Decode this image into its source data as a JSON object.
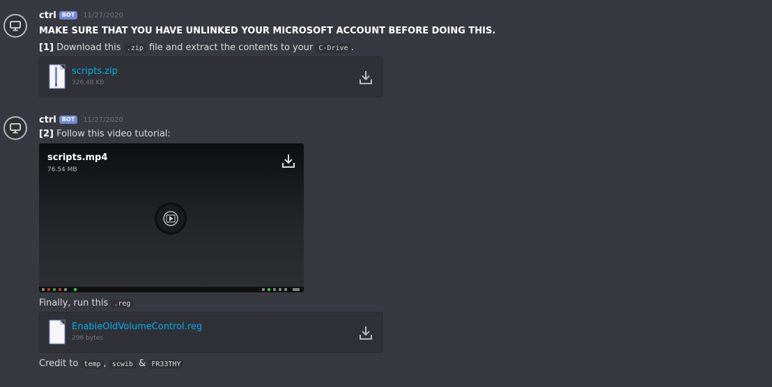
{
  "messages": [
    {
      "username": "ctrl",
      "bot_tag": "BOT",
      "timestamp": "11/27/2020",
      "heading": "MAKE SURE THAT YOU HAVE UNLINKED YOUR MICROSOFT ACCOUNT BEFORE DOING THIS.",
      "step_num": "[1]",
      "step_text_a": "Download this",
      "step_code_a": ".zip",
      "step_text_b": "file and extract the contents to your",
      "step_code_b": "C-Drive",
      "step_text_c": ".",
      "attachment": {
        "name": "scripts.zip",
        "size": "326.48 KB",
        "icon": "zip-file-icon"
      }
    },
    {
      "username": "ctrl",
      "bot_tag": "BOT",
      "timestamp": "11/27/2020",
      "step_num": "[2]",
      "step_text": "Follow this video tutorial:",
      "video": {
        "name": "scripts.mp4",
        "size": "76.54 MB"
      },
      "finally_text": "Finally, run this",
      "finally_code": ".reg",
      "attachment": {
        "name": "EnableOldVolumeControl.reg",
        "size": "296 bytes",
        "icon": "file-icon"
      },
      "credit_text": "Credit to",
      "credit_code_1": "temp",
      "credit_sep_1": ",",
      "credit_code_2": "scwib",
      "credit_sep_2": "&",
      "credit_code_3": "FR33THY"
    }
  ],
  "colors": {
    "background": "#36393f",
    "link": "#00b0f4",
    "bot_tag": "#7289da",
    "card": "#2f3136"
  }
}
